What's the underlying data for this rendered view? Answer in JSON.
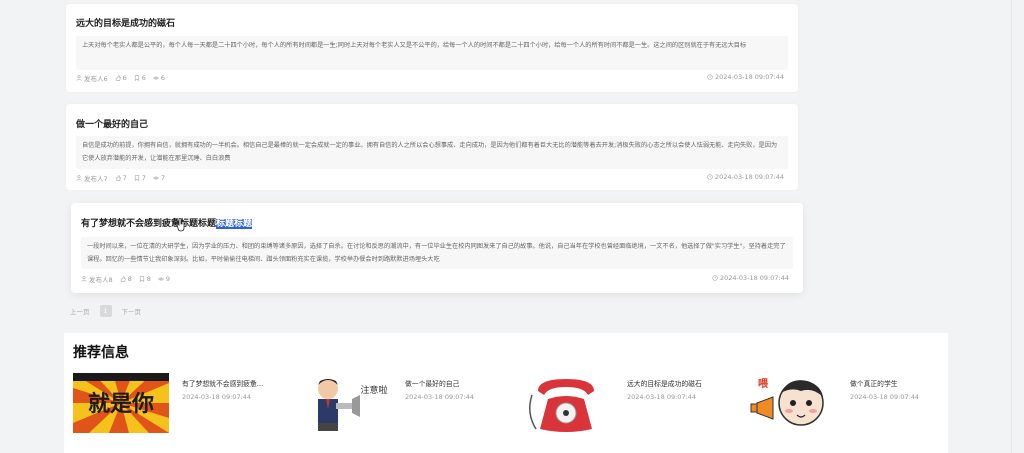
{
  "posts": [
    {
      "title": "远大的目标是成功的磁石",
      "excerpt": "上天对每个老实人都是公平的，每个人每一天都是二十四个小时，每个人的所有时间都是一生;同时上天对每个老实人又是不公平的，给每一个人的时间不都是二十四个小时，给每一个人的所有时间不都是一生。这之间的区别就在于有无远大目标",
      "author": "发布人6",
      "likes": "6",
      "comments": "6",
      "views": "6",
      "date": "2024-03-18 09:07:44"
    },
    {
      "title": "做一个最好的自己",
      "excerpt": "自信是成功的前提，你拥有自信，就拥有成功的一半机会。相信自己是最棒的就一定会成就一定的事业。拥有自信的人之所以会心想事成、走向成功，是因为他们都有着巨大无比的潜能等着去开发;消极失败的心态之所以会使人怯弱无能、走向失败，是因为它使人放弃潜能的开发，让潜能在那里沉睡、白白浪费",
      "author": "发布人7",
      "likes": "7",
      "comments": "7",
      "views": "7",
      "date": "2024-03-18 09:07:44"
    },
    {
      "title_main": "有了梦想就不会感到疲惫标题标题",
      "title_highlight": "标题标题",
      "excerpt": "一段时间以来，一位在清的大研学生，因为学业的压力、和团的束缚等诸多原因，选择了自杀。在讨论和反思的潮流中，有一位毕业生在校内同图发来了自己的故事。他说，自己当年在学校也曾经面临绝境，一文不名，他选择了做\"实习学生\"，坚持着走完了课程。回忆的一些情节让我印象深刻。比如，平时偷偷往电梯间、蹭头领面粉充实在课揽，学校举办餐会时到路默默进场埋头大吃",
      "author": "发布人8",
      "likes": "8",
      "comments": "8",
      "views": "9",
      "date": "2024-03-18 09:07:44"
    }
  ],
  "pagination": {
    "prev": "上一页",
    "current": "1",
    "next": "下一页"
  },
  "recommend": {
    "title": "推荐信息",
    "items": [
      {
        "name": "有了梦想就不会感到疲惫...",
        "date": "2024-03-18 09:07:44",
        "thumb_text": "就是你"
      },
      {
        "name": "做一个最好的自己",
        "date": "2024-03-18 09:07:44",
        "thumb_text": "注意啦"
      },
      {
        "name": "远大的目标是成功的磁石",
        "date": "2024-03-18 09:07:44",
        "thumb_text": ""
      },
      {
        "name": "做个真正的学生",
        "date": "2024-03-18 09:07:44",
        "thumb_text": "喂"
      }
    ]
  },
  "colors": {
    "highlight": "#2f62d1",
    "page_bg": "#f2f3f5",
    "card_bg": "#ffffff"
  }
}
